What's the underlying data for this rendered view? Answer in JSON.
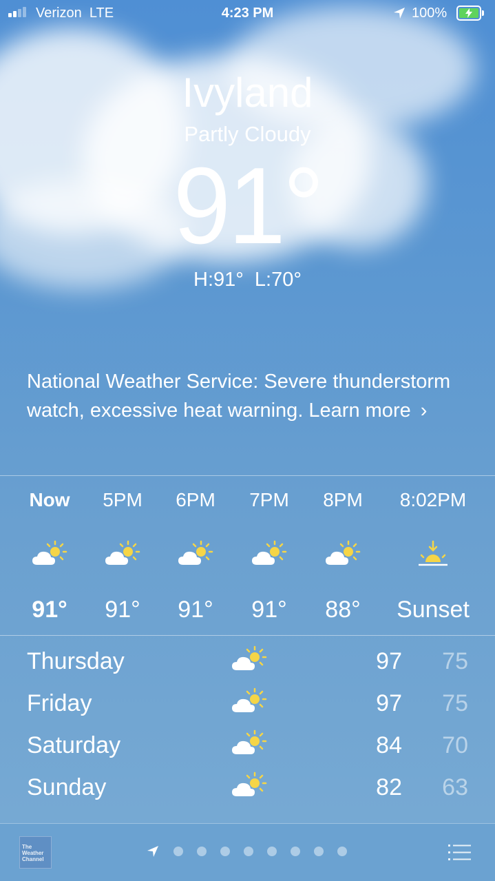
{
  "status_bar": {
    "carrier": "Verizon",
    "network": "LTE",
    "time": "4:23 PM",
    "battery_percent": "100%",
    "signal_bars": 2,
    "charging": true
  },
  "current": {
    "city": "Ivyland",
    "condition": "Partly Cloudy",
    "temperature": "91°",
    "high": "H:91°",
    "low": "L:70°"
  },
  "alert": {
    "text": "National Weather Service: Severe thunderstorm watch, excessive heat warning. Learn more",
    "chevron": "›"
  },
  "hourly": [
    {
      "label": "Now",
      "icon": "partly-cloudy-icon",
      "value": "91°"
    },
    {
      "label": "5PM",
      "icon": "partly-cloudy-icon",
      "value": "91°"
    },
    {
      "label": "6PM",
      "icon": "partly-cloudy-icon",
      "value": "91°"
    },
    {
      "label": "7PM",
      "icon": "partly-cloudy-icon",
      "value": "91°"
    },
    {
      "label": "8PM",
      "icon": "partly-cloudy-icon",
      "value": "88°"
    },
    {
      "label": "8:02PM",
      "icon": "sunset-icon",
      "value": "Sunset"
    }
  ],
  "daily": [
    {
      "day": "Thursday",
      "icon": "partly-cloudy-icon",
      "high": "97",
      "low": "75"
    },
    {
      "day": "Friday",
      "icon": "partly-cloudy-icon",
      "high": "97",
      "low": "75"
    },
    {
      "day": "Saturday",
      "icon": "partly-cloudy-icon",
      "high": "84",
      "low": "70"
    },
    {
      "day": "Sunday",
      "icon": "partly-cloudy-icon",
      "high": "82",
      "low": "63"
    }
  ],
  "toolbar": {
    "logo_line1": "The",
    "logo_line2": "Weather",
    "logo_line3": "Channel",
    "page_count": 8,
    "icons": [
      "location-arrow-icon",
      "list-icon"
    ]
  },
  "colors": {
    "sun": "#f5d547",
    "battery": "#5fd35c",
    "sky": "#5b97d1"
  }
}
